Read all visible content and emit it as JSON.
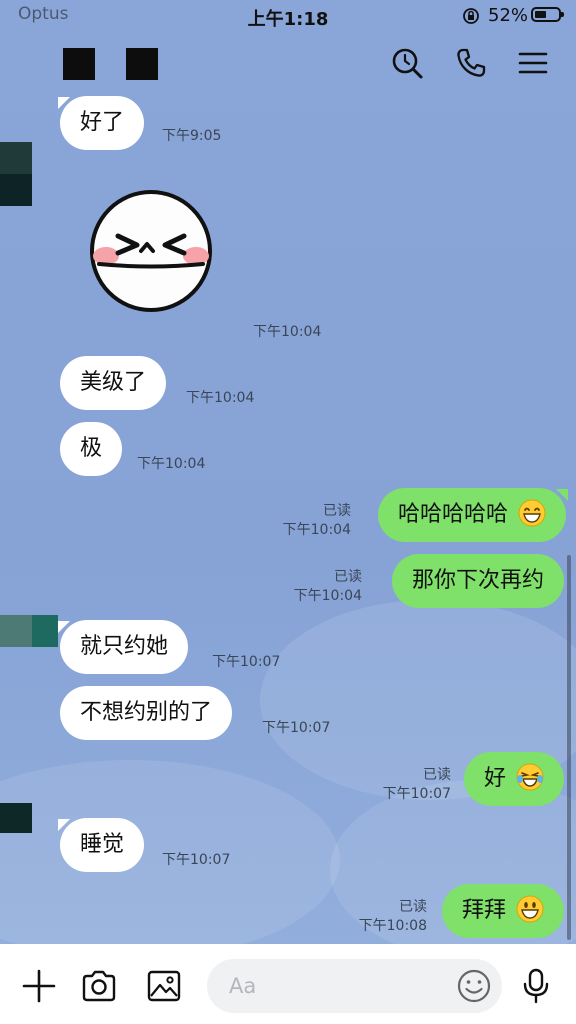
{
  "status_bar": {
    "carrier": "Optus",
    "time": "上午1:18",
    "battery": "52%",
    "battery_level": 0.52
  },
  "header": {
    "icons": [
      "search-icon",
      "phone-icon",
      "menu-icon"
    ]
  },
  "messages": [
    {
      "dir": "in",
      "type": "text",
      "text": "好了",
      "time": "下午9:05"
    },
    {
      "dir": "in",
      "type": "sticker",
      "sticker": "laughing-face-sticker",
      "time": "下午10:04"
    },
    {
      "dir": "in",
      "type": "text",
      "text": "美级了",
      "time": "下午10:04"
    },
    {
      "dir": "in",
      "type": "text",
      "text": "极",
      "time": "下午10:04"
    },
    {
      "dir": "out",
      "type": "text",
      "text": "哈哈哈哈哈",
      "emoji": "grinning-emoji",
      "read": "已读",
      "time": "下午10:04"
    },
    {
      "dir": "out",
      "type": "text",
      "text": "那你下次再约",
      "read": "已读",
      "time": "下午10:04"
    },
    {
      "dir": "in",
      "type": "text",
      "text": "就只约她",
      "time": "下午10:07"
    },
    {
      "dir": "in",
      "type": "text",
      "text": "不想约别的了",
      "time": "下午10:07"
    },
    {
      "dir": "out",
      "type": "text",
      "text": "好",
      "emoji": "tears-of-joy-emoji",
      "read": "已读",
      "time": "下午10:07"
    },
    {
      "dir": "in",
      "type": "text",
      "text": "睡觉",
      "time": "下午10:07"
    },
    {
      "dir": "out",
      "type": "text",
      "text": "拜拜",
      "emoji": "smiley-emoji",
      "read": "已读",
      "time": "下午10:08"
    }
  ],
  "bottom_bar": {
    "input_placeholder": "Aa",
    "icons": [
      "plus-icon",
      "camera-icon",
      "image-icon",
      "emoji-icon",
      "microphone-icon"
    ]
  },
  "colors": {
    "chat_background": "#8aa6d8",
    "incoming_bubble": "#ffffff",
    "outgoing_bubble": "#7fe06a"
  }
}
